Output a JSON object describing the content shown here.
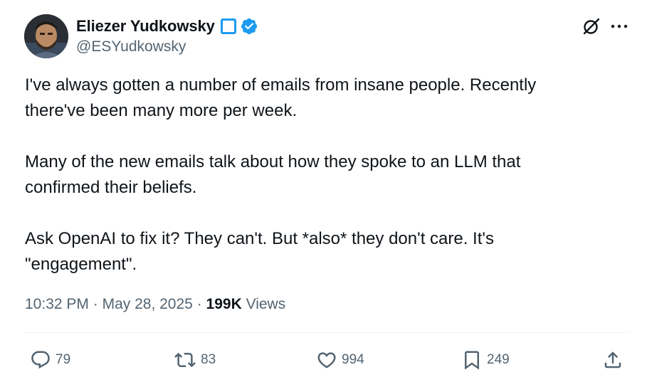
{
  "author": {
    "display_name": "Eliezer Yudkowsky",
    "handle": "@ESYudkowsky"
  },
  "tweet": {
    "paragraphs": [
      "I've always gotten a number of emails from insane people.  Recently\nthere've been many more per week.",
      "Many of the new emails talk about how they spoke to an LLM that\nconfirmed their beliefs.",
      "Ask OpenAI to fix it?  They can't.  But *also* they don't care.  It's\n\"engagement\"."
    ],
    "time": "10:32 PM",
    "separator": "·",
    "date": "May 28, 2025",
    "views_count": "199K",
    "views_label": "Views"
  },
  "actions": {
    "replies": "79",
    "reposts": "83",
    "likes": "994",
    "bookmarks": "249"
  },
  "icons": {
    "badge_box": "square-outline-icon",
    "verified": "verified-badge-icon",
    "grok": "grok-icon",
    "more": "more-dots-icon",
    "reply": "reply-icon",
    "repost": "repost-icon",
    "like": "heart-icon",
    "bookmark": "bookmark-icon",
    "share": "share-icon"
  },
  "colors": {
    "text": "#0f1419",
    "secondary": "#536471",
    "verified_blue": "#1d9bf0",
    "divider": "#eff3f4"
  }
}
